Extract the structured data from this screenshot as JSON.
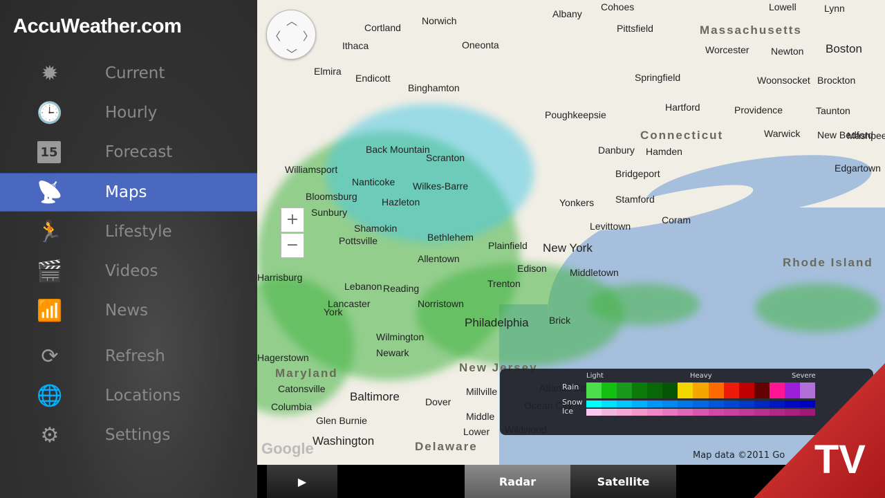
{
  "app": {
    "logo": "AccuWeather.com",
    "badge": "TV"
  },
  "sidebar": {
    "items": [
      {
        "label": "Current",
        "icon": "sun-icon",
        "glyph": "✹"
      },
      {
        "label": "Hourly",
        "icon": "clock-icon",
        "glyph": "🕒"
      },
      {
        "label": "Forecast",
        "icon": "calendar-icon",
        "glyph": "15"
      },
      {
        "label": "Maps",
        "icon": "satellite-dish-icon",
        "glyph": "📡",
        "active": true
      },
      {
        "label": "Lifestyle",
        "icon": "runner-icon",
        "glyph": "🏃"
      },
      {
        "label": "Videos",
        "icon": "clapperboard-icon",
        "glyph": "🎬"
      },
      {
        "label": "News",
        "icon": "news-feed-icon",
        "glyph": "📶"
      },
      {
        "label": "Refresh",
        "icon": "refresh-icon",
        "glyph": "⟳"
      },
      {
        "label": "Locations",
        "icon": "globe-icon",
        "glyph": "🌐"
      },
      {
        "label": "Settings",
        "icon": "gear-icon",
        "glyph": "⚙"
      }
    ]
  },
  "map": {
    "cities": [
      "Albany",
      "Pittsfield",
      "Cohoes",
      "Lowell",
      "Lynn",
      "Boston",
      "Worcester",
      "Newton",
      "Springfield",
      "Woonsocket",
      "Brockton",
      "Hartford",
      "Providence",
      "Taunton",
      "Warwick",
      "New Bedford",
      "Cortland",
      "Norwich",
      "Ithaca",
      "Oneonta",
      "Elmira",
      "Endicott",
      "Binghamton",
      "Poughkeepsie",
      "Danbury",
      "Hamden",
      "Bridgeport",
      "Stamford",
      "Yonkers",
      "Levittown",
      "Coram",
      "New York",
      "Middletown",
      "Plainfield",
      "Edison",
      "Trenton",
      "Brick",
      "Philadelphia",
      "Scranton",
      "Wilkes-Barre",
      "Back Mountain",
      "Williamsport",
      "Nanticoke",
      "Hazleton",
      "Bloomsburg",
      "Sunbury",
      "Shamokin",
      "Pottsville",
      "Bethlehem",
      "Allentown",
      "Harrisburg",
      "Lebanon",
      "Reading",
      "Lancaster",
      "Norristown",
      "York",
      "Wilmington",
      "Newark",
      "Hagerstown",
      "Catonsville",
      "Baltimore",
      "Columbia",
      "Glen Burnie",
      "Washington",
      "Dover",
      "Millville",
      "Atlantic City",
      "Ocean City",
      "Middle",
      "Lower",
      "Wildwood",
      "Edgartown",
      "Mashpee"
    ],
    "states": [
      "Massachusetts",
      "Connecticut",
      "Rhode Island",
      "New Jersey",
      "Maryland",
      "Delaware"
    ],
    "attribution": "Map data ©2011 Go",
    "google_logo": "Google",
    "zoom_in": "+",
    "zoom_out": "−"
  },
  "legend": {
    "light": "Light",
    "heavy": "Heavy",
    "severe": "Severe",
    "rows": [
      "Rain",
      "Snow",
      "Ice"
    ],
    "rain_colors": [
      "#4be04b",
      "#11c011",
      "#1a9a1a",
      "#0b7a0b",
      "#086808",
      "#055505",
      "#f2d600",
      "#f4a700",
      "#ff6a00",
      "#ee1a0a",
      "#c00000",
      "#650000",
      "#ff1493",
      "#9b1ed8",
      "#b070d8"
    ],
    "snow_colors": [
      "#00ffff",
      "#00e0ff",
      "#00c8ff",
      "#00b0ff",
      "#0098f8",
      "#0088f0",
      "#0078e8",
      "#0068e0",
      "#0058d8",
      "#0048d0",
      "#0038c8",
      "#0028c0",
      "#0018c0",
      "#0008c0",
      "#0000c0"
    ],
    "ice_colors": [
      "#f8c8f0",
      "#f0b8e0",
      "#f8a8d8",
      "#f498cc",
      "#f088c8",
      "#e878c0",
      "#e068b8",
      "#d858b0",
      "#d048a8",
      "#c840a0",
      "#c03898",
      "#b83090",
      "#b02888",
      "#a82080",
      "#a01878"
    ]
  },
  "bottombar": {
    "play": "▶",
    "tabs": [
      {
        "label": "Radar",
        "active": true
      },
      {
        "label": "Satellite"
      }
    ]
  }
}
